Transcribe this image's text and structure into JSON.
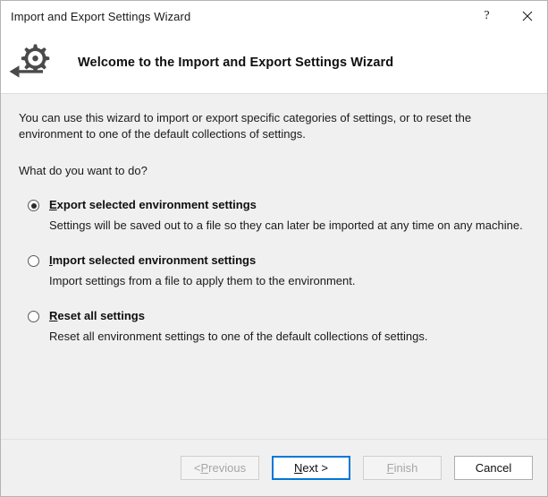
{
  "window": {
    "title": "Import and Export Settings Wizard",
    "help_icon": "question-mark-icon",
    "help_glyph": "?",
    "close_icon": "close-icon"
  },
  "header": {
    "icon": "settings-gear-export-icon",
    "title": "Welcome to the Import and Export Settings Wizard"
  },
  "body": {
    "intro": "You can use this wizard to import or export specific categories of settings, or to reset the environment to one of the default collections of settings.",
    "question": "What do you want to do?",
    "options": [
      {
        "accel": "E",
        "label_rest": "xport selected environment settings",
        "description": "Settings will be saved out to a file so they can later be imported at any time on any machine.",
        "selected": true
      },
      {
        "accel": "I",
        "label_rest": "mport selected environment settings",
        "description": "Import settings from a file to apply them to the environment.",
        "selected": false
      },
      {
        "accel": "R",
        "label_rest": "eset all settings",
        "description": "Reset all environment settings to one of the default collections of settings.",
        "selected": false
      }
    ]
  },
  "footer": {
    "buttons": [
      {
        "name": "previous",
        "prefix": "< ",
        "accel": "P",
        "suffix": "revious",
        "state": "disabled"
      },
      {
        "name": "next",
        "prefix": "",
        "accel": "N",
        "suffix": "ext >",
        "state": "default"
      },
      {
        "name": "finish",
        "prefix": "",
        "accel": "F",
        "suffix": "inish",
        "state": "disabled"
      },
      {
        "name": "cancel",
        "prefix": "",
        "accel": "",
        "suffix": "Cancel",
        "state": "normal"
      }
    ]
  },
  "colors": {
    "accent": "#0078d7",
    "body_background": "#f0f0f0",
    "header_background": "#ffffff",
    "text": "#1a1a1a",
    "disabled_text": "#a6a6a6"
  }
}
